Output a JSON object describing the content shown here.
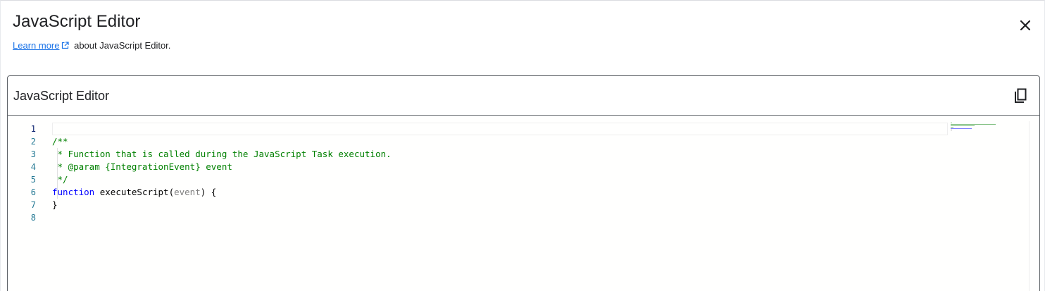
{
  "dialog": {
    "title": "JavaScript Editor",
    "close_icon": "close-icon",
    "learn_more_label": "Learn more",
    "external_icon": "open-in-new-icon",
    "subtitle_suffix": " about JavaScript Editor."
  },
  "panel": {
    "title": "JavaScript Editor",
    "copy_icon": "copy-icon"
  },
  "editor": {
    "line_numbers": [
      "1",
      "2",
      "3",
      "4",
      "5",
      "6",
      "7",
      "8"
    ],
    "active_line": "1",
    "lines": [
      [],
      [
        {
          "type": "comment",
          "text": "/**"
        }
      ],
      [
        {
          "type": "comment",
          "text": " * Function that is called during the JavaScript Task execution."
        }
      ],
      [
        {
          "type": "comment",
          "text": " * @param {IntegrationEvent} event"
        }
      ],
      [
        {
          "type": "comment",
          "text": " */"
        }
      ],
      [
        {
          "type": "keyword",
          "text": "function"
        },
        {
          "type": "plain",
          "text": " executeScript("
        },
        {
          "type": "param",
          "text": "event"
        },
        {
          "type": "plain",
          "text": ") {"
        }
      ],
      [
        {
          "type": "plain",
          "text": "}"
        }
      ],
      []
    ]
  },
  "colors": {
    "accent": "#1a73e8",
    "comment": "#008000",
    "keyword": "#0000ff",
    "param": "#808080",
    "line_number": "#237893"
  }
}
